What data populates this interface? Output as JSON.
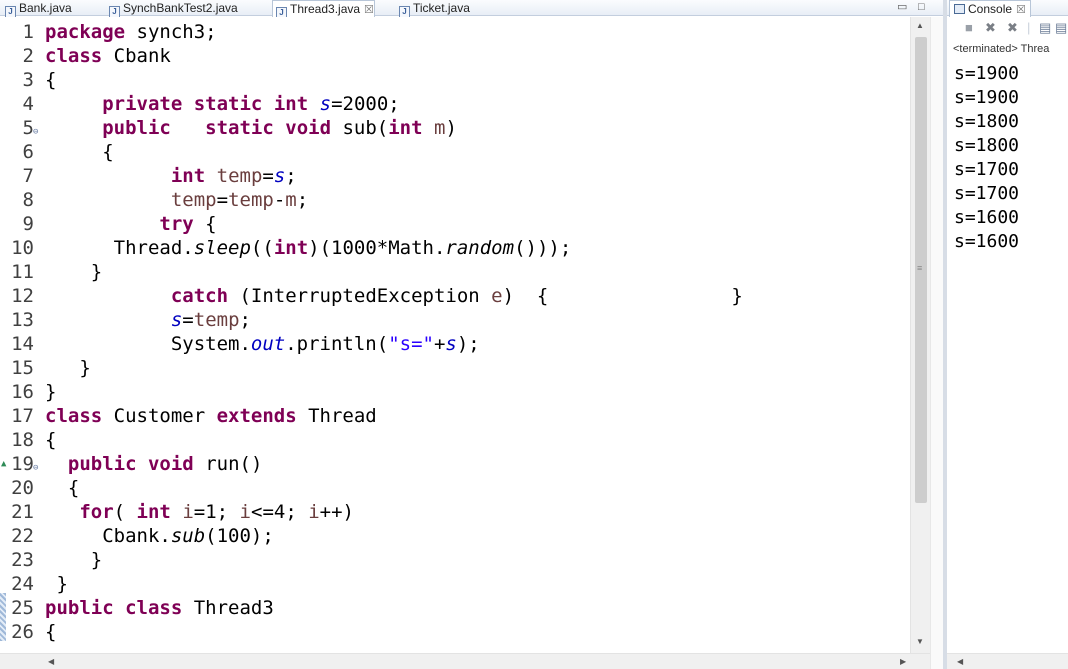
{
  "editor_tabs": [
    {
      "label": "Bank.java",
      "active": false
    },
    {
      "label": "SynchBankTest2.java",
      "active": false
    },
    {
      "label": "Thread3.java",
      "active": true
    },
    {
      "label": "Ticket.java",
      "active": false
    }
  ],
  "java_file_icon": "J",
  "close_glyph": "☒",
  "window_controls": {
    "minimize": "▭",
    "maximize": "□"
  },
  "code_lines": [
    {
      "n": "1",
      "tokens": [
        [
          "kw",
          "package"
        ],
        [
          "t",
          " synch3;"
        ]
      ]
    },
    {
      "n": "2",
      "tokens": [
        [
          "kw",
          "class"
        ],
        [
          "t",
          " Cbank"
        ]
      ]
    },
    {
      "n": "3",
      "tokens": [
        [
          "t",
          "{"
        ]
      ]
    },
    {
      "n": "4",
      "tokens": [
        [
          "t",
          "     "
        ],
        [
          "kw",
          "private"
        ],
        [
          "t",
          " "
        ],
        [
          "kw",
          "static"
        ],
        [
          "t",
          " "
        ],
        [
          "kw",
          "int"
        ],
        [
          "t",
          " "
        ],
        [
          "fld",
          "s"
        ],
        [
          "t",
          "=2000;"
        ]
      ]
    },
    {
      "n": "5",
      "fold": true,
      "tokens": [
        [
          "t",
          "     "
        ],
        [
          "kw",
          "public"
        ],
        [
          "t",
          "   "
        ],
        [
          "kw",
          "static"
        ],
        [
          "t",
          " "
        ],
        [
          "kw",
          "void"
        ],
        [
          "t",
          " sub("
        ],
        [
          "kw",
          "int"
        ],
        [
          "t",
          " "
        ],
        [
          "par",
          "m"
        ],
        [
          "t",
          ")"
        ]
      ]
    },
    {
      "n": "6",
      "tokens": [
        [
          "t",
          "     {"
        ]
      ]
    },
    {
      "n": "7",
      "tokens": [
        [
          "t",
          "           "
        ],
        [
          "kw",
          "int"
        ],
        [
          "t",
          " "
        ],
        [
          "par",
          "temp"
        ],
        [
          "t",
          "="
        ],
        [
          "fld",
          "s"
        ],
        [
          "t",
          ";"
        ]
      ]
    },
    {
      "n": "8",
      "tokens": [
        [
          "t",
          "           "
        ],
        [
          "par",
          "temp"
        ],
        [
          "t",
          "="
        ],
        [
          "par",
          "temp"
        ],
        [
          "t",
          "-"
        ],
        [
          "par",
          "m"
        ],
        [
          "t",
          ";"
        ]
      ]
    },
    {
      "n": "9",
      "tokens": [
        [
          "t",
          "          "
        ],
        [
          "kw",
          "try"
        ],
        [
          "t",
          " {"
        ]
      ]
    },
    {
      "n": "10",
      "tokens": [
        [
          "t",
          "      Thread."
        ],
        [
          "itl",
          "sleep"
        ],
        [
          "t",
          "(("
        ],
        [
          "kw",
          "int"
        ],
        [
          "t",
          ")(1000*Math."
        ],
        [
          "itl",
          "random"
        ],
        [
          "t",
          "()));"
        ]
      ]
    },
    {
      "n": "11",
      "tokens": [
        [
          "t",
          "    }"
        ]
      ]
    },
    {
      "n": "12",
      "tokens": [
        [
          "t",
          "           "
        ],
        [
          "kw",
          "catch"
        ],
        [
          "t",
          " (InterruptedException "
        ],
        [
          "par",
          "e"
        ],
        [
          "t",
          ")  {                }"
        ]
      ]
    },
    {
      "n": "13",
      "tokens": [
        [
          "t",
          "           "
        ],
        [
          "fld",
          "s"
        ],
        [
          "t",
          "="
        ],
        [
          "par",
          "temp"
        ],
        [
          "t",
          ";"
        ]
      ]
    },
    {
      "n": "14",
      "tokens": [
        [
          "t",
          "           System."
        ],
        [
          "fld",
          "out"
        ],
        [
          "t",
          ".println("
        ],
        [
          "str",
          "\"s=\""
        ],
        [
          "t",
          "+"
        ],
        [
          "fld",
          "s"
        ],
        [
          "t",
          ");"
        ]
      ]
    },
    {
      "n": "15",
      "tokens": [
        [
          "t",
          "   }"
        ]
      ]
    },
    {
      "n": "16",
      "tokens": [
        [
          "t",
          "}"
        ]
      ]
    },
    {
      "n": "17",
      "tokens": [
        [
          "kw",
          "class"
        ],
        [
          "t",
          " Customer "
        ],
        [
          "kw",
          "extends"
        ],
        [
          "t",
          " Thread"
        ]
      ]
    },
    {
      "n": "18",
      "tokens": [
        [
          "t",
          "{"
        ]
      ]
    },
    {
      "n": "19",
      "fold": true,
      "override": true,
      "tokens": [
        [
          "t",
          "  "
        ],
        [
          "kw",
          "public"
        ],
        [
          "t",
          " "
        ],
        [
          "kw",
          "void"
        ],
        [
          "t",
          " run()"
        ]
      ]
    },
    {
      "n": "20",
      "tokens": [
        [
          "t",
          "  {"
        ]
      ]
    },
    {
      "n": "21",
      "tokens": [
        [
          "t",
          "   "
        ],
        [
          "kw",
          "for"
        ],
        [
          "t",
          "( "
        ],
        [
          "kw",
          "int"
        ],
        [
          "t",
          " "
        ],
        [
          "par",
          "i"
        ],
        [
          "t",
          "=1; "
        ],
        [
          "par",
          "i"
        ],
        [
          "t",
          "<=4; "
        ],
        [
          "par",
          "i"
        ],
        [
          "t",
          "++)"
        ]
      ]
    },
    {
      "n": "22",
      "tokens": [
        [
          "t",
          "     Cbank."
        ],
        [
          "itl",
          "sub"
        ],
        [
          "t",
          "(100);"
        ]
      ]
    },
    {
      "n": "23",
      "tokens": [
        [
          "t",
          "    }"
        ]
      ]
    },
    {
      "n": "24",
      "tokens": [
        [
          "t",
          " }"
        ]
      ]
    },
    {
      "n": "25",
      "tokens": [
        [
          "kw",
          "public"
        ],
        [
          "t",
          " "
        ],
        [
          "kw",
          "class"
        ],
        [
          "t",
          " Thread3"
        ]
      ]
    },
    {
      "n": "26",
      "tokens": [
        [
          "t",
          "{"
        ]
      ]
    }
  ],
  "console": {
    "tab_label": "Console",
    "status": "<terminated> Threa",
    "toolbar_icons": [
      "stop-icon",
      "remove-launch-icon",
      "remove-all-icon",
      "pin-icon",
      "clear-console-icon"
    ],
    "output": [
      "s=1900",
      "s=1900",
      "s=1800",
      "s=1800",
      "s=1700",
      "s=1700",
      "s=1600",
      "s=1600"
    ]
  }
}
